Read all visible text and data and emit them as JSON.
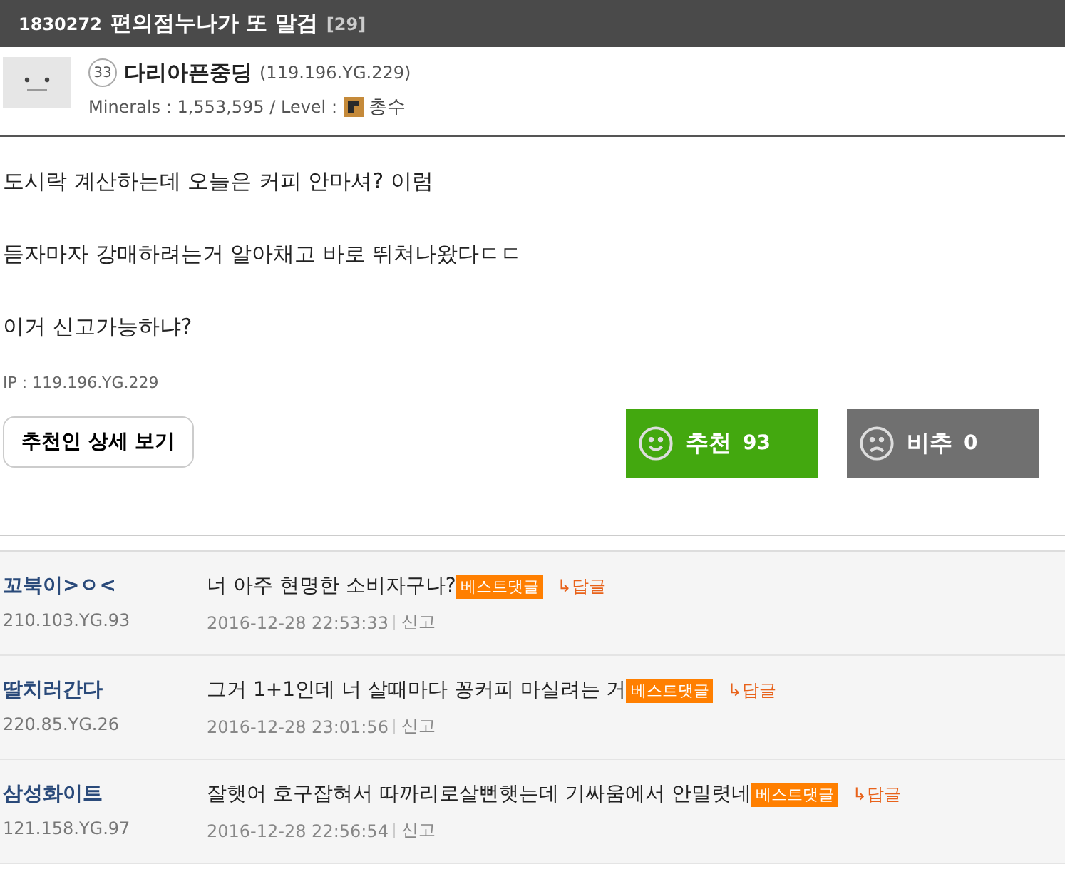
{
  "post": {
    "number": "1830272",
    "title": "편의점누나가 또 말검",
    "comment_count": "[29]"
  },
  "author": {
    "level_badge": "33",
    "name": "다리아픈중딩",
    "ip": "(119.196.YG.229)",
    "minerals": "Minerals : 1,553,595 / Level :",
    "level_name": "총수"
  },
  "body": [
    "도시락 계산하는데 오늘은 커피 안마셔? 이럼",
    "듣자마자 강매하려는거 알아채고 바로 뛰쳐나왔다ㄷㄷ",
    "이거 신고가능하냐?"
  ],
  "ip_line": "IP : 119.196.YG.229",
  "recommenders_button": "추천인 상세 보기",
  "votes": [
    {
      "kind": "up",
      "label": "추천",
      "count": "93"
    },
    {
      "kind": "down",
      "label": "비추",
      "count": "0"
    }
  ],
  "comments": [
    {
      "nick": "꼬북이>ㅇ<",
      "ip": "210.103.YG.93",
      "text": "너 아주 현명한 소비자구나?",
      "badge": "베스트댓글",
      "reply": "↳답글",
      "date": "2016-12-28 22:53:33",
      "report": "신고"
    },
    {
      "nick": "딸치러간다",
      "ip": "220.85.YG.26",
      "text": "그거 1+1인데 너 살때마다 꽁커피 마실려는 거",
      "badge": "베스트댓글",
      "reply": "↳답글",
      "date": "2016-12-28 23:01:56",
      "report": "신고"
    },
    {
      "nick": "삼성화이트",
      "ip": "121.158.YG.97",
      "text": "잘햇어 호구잡혀서 따까리로살뻔햇는데 기싸움에서 안밀렷네",
      "badge": "베스트댓글",
      "reply": "↳답글",
      "date": "2016-12-28 22:56:54",
      "report": "신고"
    }
  ]
}
